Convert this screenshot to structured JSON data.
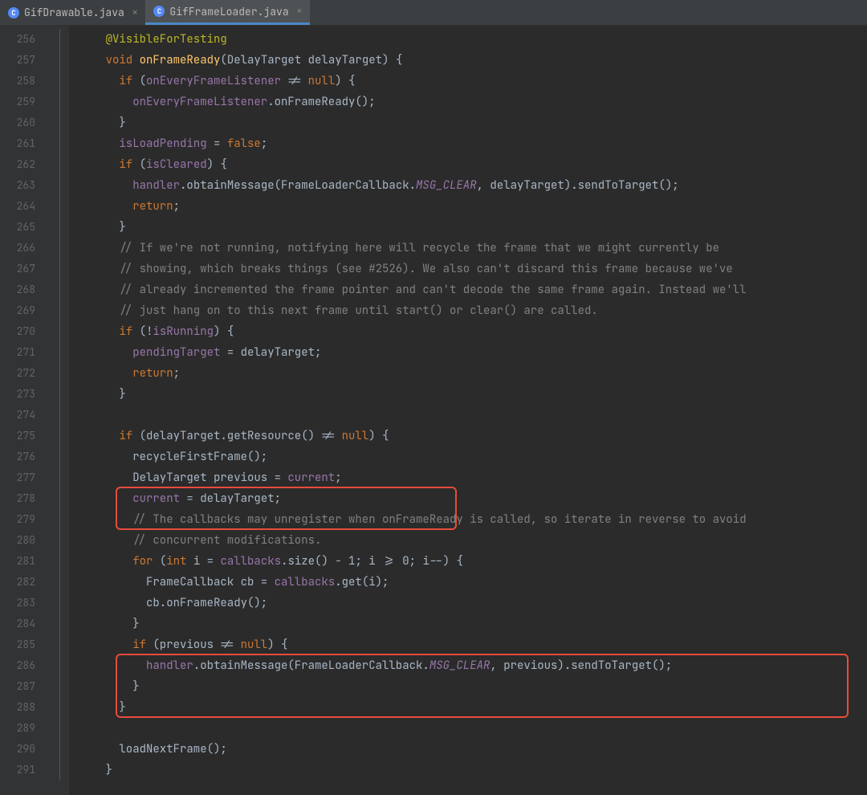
{
  "tabs": [
    {
      "label": "GifDrawable.java",
      "active": false
    },
    {
      "label": "GifFrameLoader.java",
      "active": true
    }
  ],
  "startLine": 256,
  "lines": [
    {
      "n": "256",
      "segs": [
        {
          "t": "    ",
          "c": ""
        },
        {
          "t": "@VisibleForTesting",
          "c": "annotation"
        }
      ]
    },
    {
      "n": "257",
      "segs": [
        {
          "t": "    ",
          "c": ""
        },
        {
          "t": "void ",
          "c": "kw"
        },
        {
          "t": "onFrameReady",
          "c": "method-decl"
        },
        {
          "t": "(DelayTarget delayTarget) {",
          "c": ""
        }
      ]
    },
    {
      "n": "258",
      "segs": [
        {
          "t": "      ",
          "c": ""
        },
        {
          "t": "if ",
          "c": "kw"
        },
        {
          "t": "(",
          "c": ""
        },
        {
          "t": "onEveryFrameListener",
          "c": "field"
        },
        {
          "t": " != ",
          "c": ""
        },
        {
          "t": "null",
          "c": "kw"
        },
        {
          "t": ") {",
          "c": ""
        }
      ]
    },
    {
      "n": "259",
      "segs": [
        {
          "t": "        ",
          "c": ""
        },
        {
          "t": "onEveryFrameListener",
          "c": "field"
        },
        {
          "t": ".onFrameReady();",
          "c": ""
        }
      ]
    },
    {
      "n": "260",
      "segs": [
        {
          "t": "      }",
          "c": ""
        }
      ]
    },
    {
      "n": "261",
      "segs": [
        {
          "t": "      ",
          "c": ""
        },
        {
          "t": "isLoadPending",
          "c": "field"
        },
        {
          "t": " = ",
          "c": ""
        },
        {
          "t": "false",
          "c": "kw"
        },
        {
          "t": ";",
          "c": ""
        }
      ]
    },
    {
      "n": "262",
      "segs": [
        {
          "t": "      ",
          "c": ""
        },
        {
          "t": "if ",
          "c": "kw"
        },
        {
          "t": "(",
          "c": ""
        },
        {
          "t": "isCleared",
          "c": "field"
        },
        {
          "t": ") {",
          "c": ""
        }
      ]
    },
    {
      "n": "263",
      "segs": [
        {
          "t": "        ",
          "c": ""
        },
        {
          "t": "handler",
          "c": "field"
        },
        {
          "t": ".obtainMessage(FrameLoaderCallback.",
          "c": ""
        },
        {
          "t": "MSG_CLEAR",
          "c": "static-field"
        },
        {
          "t": ", delayTarget).sendToTarget();",
          "c": ""
        }
      ]
    },
    {
      "n": "264",
      "segs": [
        {
          "t": "        ",
          "c": ""
        },
        {
          "t": "return",
          "c": "kw"
        },
        {
          "t": ";",
          "c": ""
        }
      ]
    },
    {
      "n": "265",
      "segs": [
        {
          "t": "      }",
          "c": ""
        }
      ]
    },
    {
      "n": "266",
      "segs": [
        {
          "t": "      ",
          "c": ""
        },
        {
          "t": "// If we're not running, notifying here will recycle the frame that we might currently be",
          "c": "comment"
        }
      ]
    },
    {
      "n": "267",
      "segs": [
        {
          "t": "      ",
          "c": ""
        },
        {
          "t": "// showing, which breaks things (see #2526). We also can't discard this frame because we've",
          "c": "comment"
        }
      ]
    },
    {
      "n": "268",
      "segs": [
        {
          "t": "      ",
          "c": ""
        },
        {
          "t": "// already incremented the frame pointer and can't decode the same frame again. Instead we'll",
          "c": "comment"
        }
      ]
    },
    {
      "n": "269",
      "segs": [
        {
          "t": "      ",
          "c": ""
        },
        {
          "t": "// just hang on to this next frame until start() or clear() are called.",
          "c": "comment"
        }
      ]
    },
    {
      "n": "270",
      "segs": [
        {
          "t": "      ",
          "c": ""
        },
        {
          "t": "if ",
          "c": "kw"
        },
        {
          "t": "(!",
          "c": ""
        },
        {
          "t": "isRunning",
          "c": "field"
        },
        {
          "t": ") {",
          "c": ""
        }
      ]
    },
    {
      "n": "271",
      "segs": [
        {
          "t": "        ",
          "c": ""
        },
        {
          "t": "pendingTarget",
          "c": "field"
        },
        {
          "t": " = delayTarget;",
          "c": ""
        }
      ]
    },
    {
      "n": "272",
      "segs": [
        {
          "t": "        ",
          "c": ""
        },
        {
          "t": "return",
          "c": "kw"
        },
        {
          "t": ";",
          "c": ""
        }
      ]
    },
    {
      "n": "273",
      "segs": [
        {
          "t": "      }",
          "c": ""
        }
      ]
    },
    {
      "n": "274",
      "segs": [
        {
          "t": "",
          "c": ""
        }
      ]
    },
    {
      "n": "275",
      "segs": [
        {
          "t": "      ",
          "c": ""
        },
        {
          "t": "if ",
          "c": "kw"
        },
        {
          "t": "(delayTarget.getResource() != ",
          "c": ""
        },
        {
          "t": "null",
          "c": "kw"
        },
        {
          "t": ") {",
          "c": ""
        }
      ]
    },
    {
      "n": "276",
      "segs": [
        {
          "t": "        recycleFirstFrame();",
          "c": ""
        }
      ]
    },
    {
      "n": "277",
      "segs": [
        {
          "t": "        DelayTarget previous = ",
          "c": ""
        },
        {
          "t": "current",
          "c": "field"
        },
        {
          "t": ";",
          "c": ""
        }
      ]
    },
    {
      "n": "278",
      "segs": [
        {
          "t": "        ",
          "c": ""
        },
        {
          "t": "current",
          "c": "field"
        },
        {
          "t": " = delayTarget;",
          "c": ""
        }
      ]
    },
    {
      "n": "279",
      "segs": [
        {
          "t": "        ",
          "c": ""
        },
        {
          "t": "// The callbacks may unregister when onFrameReady is called, so iterate in reverse to avoid",
          "c": "comment"
        }
      ]
    },
    {
      "n": "280",
      "segs": [
        {
          "t": "        ",
          "c": ""
        },
        {
          "t": "// concurrent modifications.",
          "c": "comment"
        }
      ]
    },
    {
      "n": "281",
      "segs": [
        {
          "t": "        ",
          "c": ""
        },
        {
          "t": "for ",
          "c": "kw"
        },
        {
          "t": "(",
          "c": ""
        },
        {
          "t": "int ",
          "c": "kw"
        },
        {
          "t": "i = ",
          "c": ""
        },
        {
          "t": "callbacks",
          "c": "field"
        },
        {
          "t": ".size() - ",
          "c": ""
        },
        {
          "t": "1",
          "c": ""
        },
        {
          "t": "; i >= ",
          "c": ""
        },
        {
          "t": "0",
          "c": ""
        },
        {
          "t": "; i--) {",
          "c": ""
        }
      ]
    },
    {
      "n": "282",
      "segs": [
        {
          "t": "          FrameCallback cb = ",
          "c": ""
        },
        {
          "t": "callbacks",
          "c": "field"
        },
        {
          "t": ".get(i);",
          "c": ""
        }
      ]
    },
    {
      "n": "283",
      "segs": [
        {
          "t": "          cb.onFrameReady();",
          "c": ""
        }
      ]
    },
    {
      "n": "284",
      "segs": [
        {
          "t": "        }",
          "c": ""
        }
      ]
    },
    {
      "n": "285",
      "segs": [
        {
          "t": "        ",
          "c": ""
        },
        {
          "t": "if ",
          "c": "kw"
        },
        {
          "t": "(previous != ",
          "c": ""
        },
        {
          "t": "null",
          "c": "kw"
        },
        {
          "t": ") {",
          "c": ""
        }
      ]
    },
    {
      "n": "286",
      "segs": [
        {
          "t": "          ",
          "c": ""
        },
        {
          "t": "handler",
          "c": "field"
        },
        {
          "t": ".obtainMessage(FrameLoaderCallback.",
          "c": ""
        },
        {
          "t": "MSG_CLEAR",
          "c": "static-field"
        },
        {
          "t": ", previous).sendToTarget();",
          "c": ""
        }
      ]
    },
    {
      "n": "287",
      "segs": [
        {
          "t": "        }",
          "c": ""
        }
      ]
    },
    {
      "n": "288",
      "segs": [
        {
          "t": "      }",
          "c": ""
        }
      ]
    },
    {
      "n": "289",
      "segs": [
        {
          "t": "",
          "c": ""
        }
      ]
    },
    {
      "n": "290",
      "segs": [
        {
          "t": "      loadNextFrame();",
          "c": ""
        }
      ]
    },
    {
      "n": "291",
      "segs": [
        {
          "t": "    }",
          "c": ""
        }
      ]
    }
  ]
}
